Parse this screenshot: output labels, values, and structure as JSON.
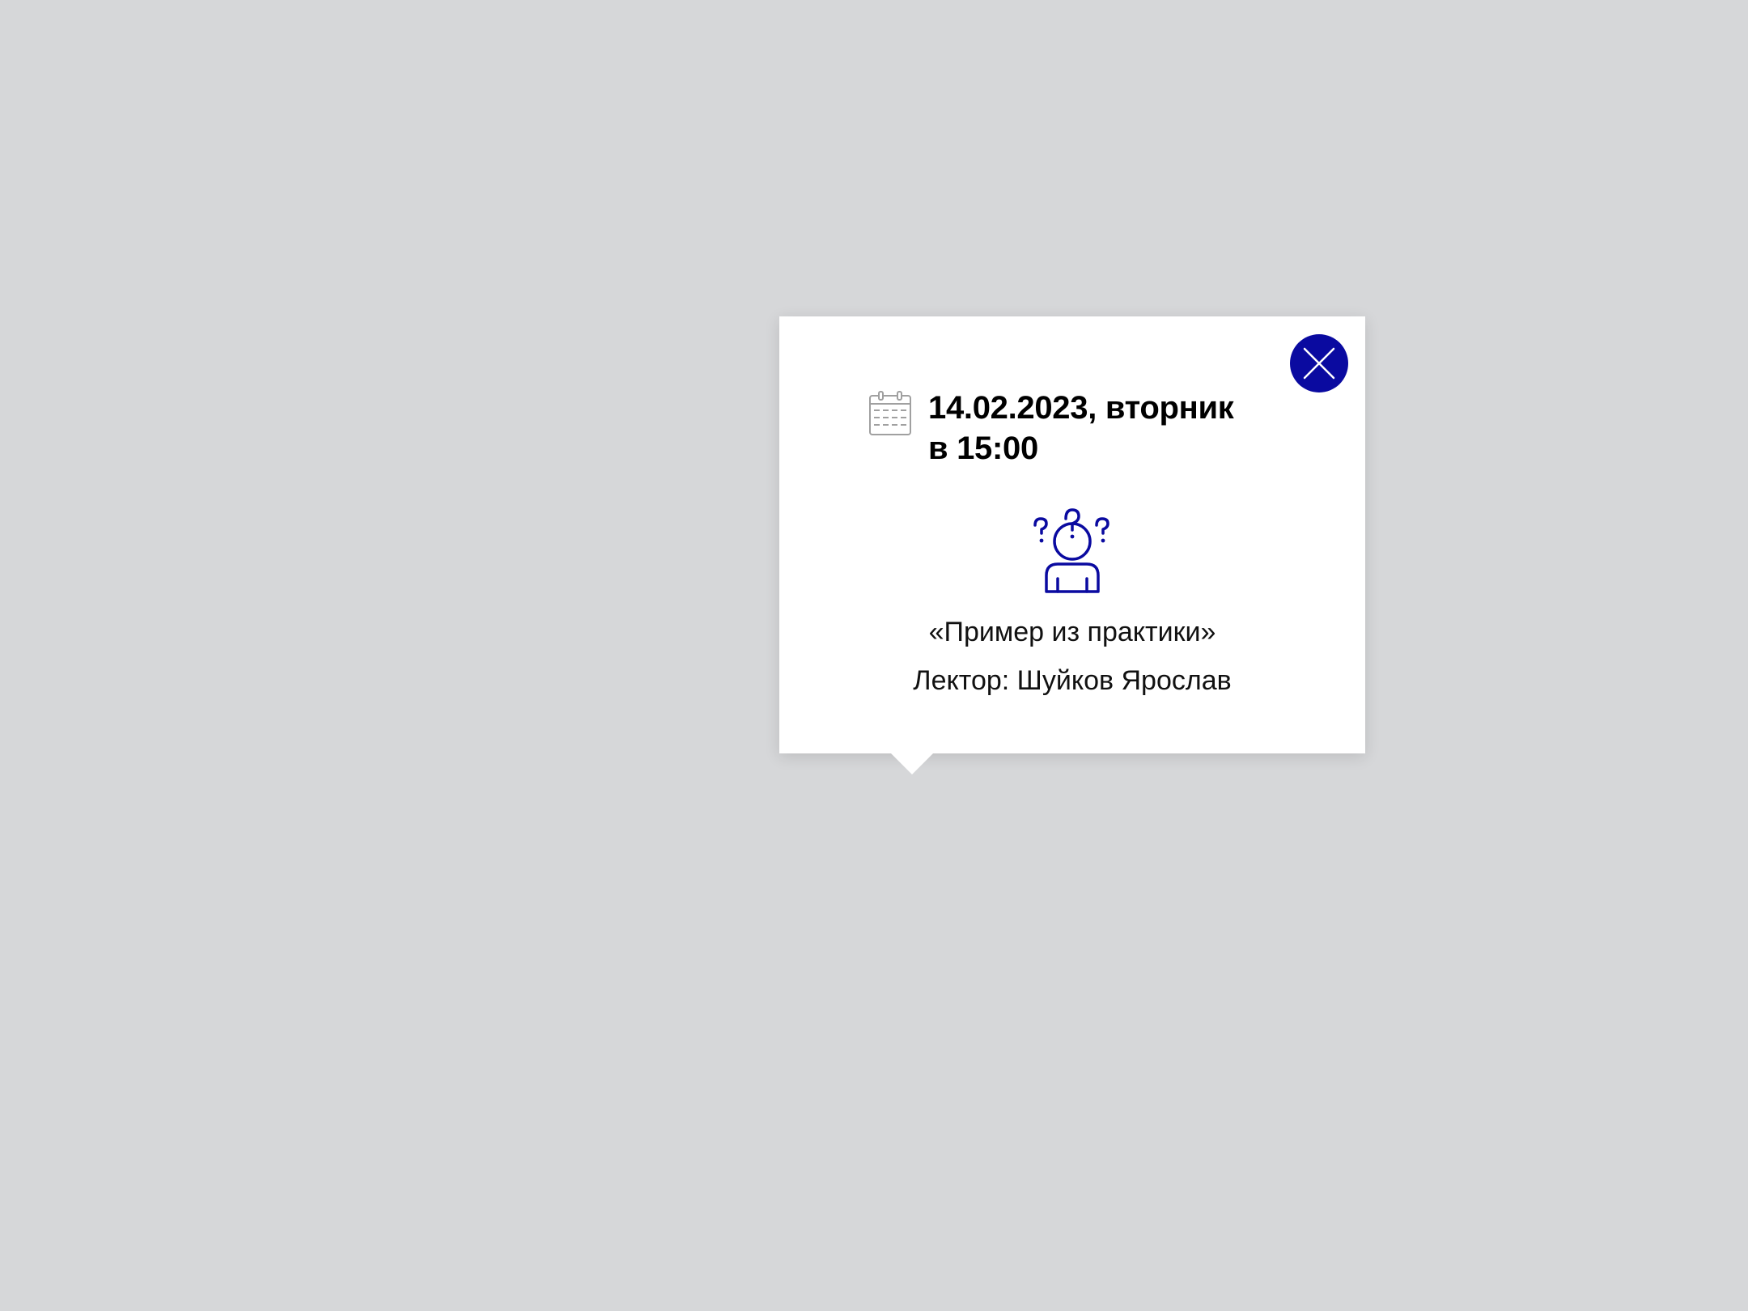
{
  "popup": {
    "date_line1": "14.02.2023, вторник",
    "date_line2": "в 15:00",
    "title": "«Пример из практики»",
    "lecturer": "Лектор: Шуйков Ярослав",
    "close_icon": "close-icon",
    "calendar_icon": "calendar-icon",
    "topic_icon": "confused-person-icon"
  },
  "colors": {
    "background": "#d6d7d9",
    "popup_bg": "#ffffff",
    "accent": "#0a0aa0",
    "calendar_gray": "#a0a0a0"
  }
}
